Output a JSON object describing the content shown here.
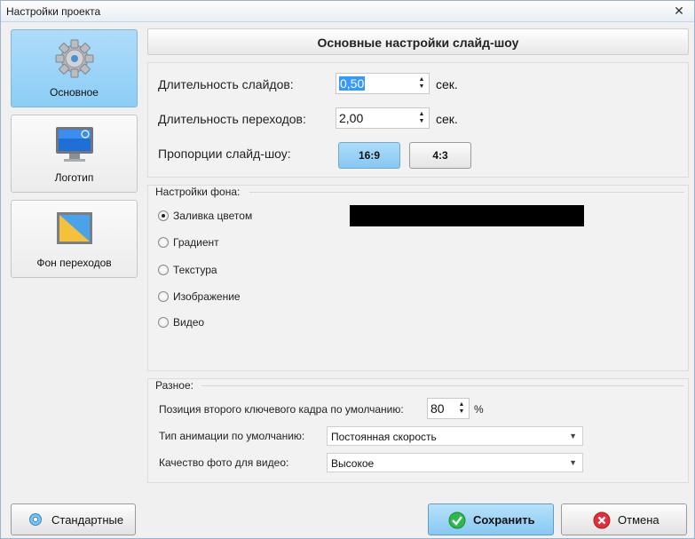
{
  "window": {
    "title": "Настройки проекта",
    "close": "✕"
  },
  "sidebar": {
    "items": [
      {
        "label": "Основное",
        "icon": "gear-icon",
        "active": true
      },
      {
        "label": "Логотип",
        "icon": "monitor-icon",
        "active": false
      },
      {
        "label": "Фон переходов",
        "icon": "picture-icon",
        "active": false
      }
    ]
  },
  "header": {
    "title": "Основные настройки слайд-шоу"
  },
  "main": {
    "slide_duration_label": "Длительность слайдов:",
    "slide_duration_value": "0,50",
    "transition_duration_label": "Длительность переходов:",
    "transition_duration_value": "2,00",
    "unit_seconds": "сек.",
    "aspect_label": "Пропорции слайд-шоу:",
    "aspect_options": [
      "16:9",
      "4:3"
    ],
    "aspect_selected": "16:9"
  },
  "background": {
    "title": "Настройки фона:",
    "options": [
      "Заливка цветом",
      "Градиент",
      "Текстура",
      "Изображение",
      "Видео"
    ],
    "selected": "Заливка цветом",
    "fill_color": "#000000"
  },
  "misc": {
    "title": "Разное:",
    "keyframe_label": "Позиция второго ключевого кадра по умолчанию:",
    "keyframe_value": "80",
    "keyframe_unit": "%",
    "animation_label": "Тип анимации по умолчанию:",
    "animation_value": "Постоянная скорость",
    "quality_label": "Качество фото для видео:",
    "quality_value": "Высокое"
  },
  "footer": {
    "defaults_label": "Стандартные",
    "save_label": "Сохранить",
    "cancel_label": "Отмена"
  },
  "colors": {
    "accent": "#8ccdf6",
    "save_check": "#2db84a",
    "cancel_x": "#e0303a"
  }
}
